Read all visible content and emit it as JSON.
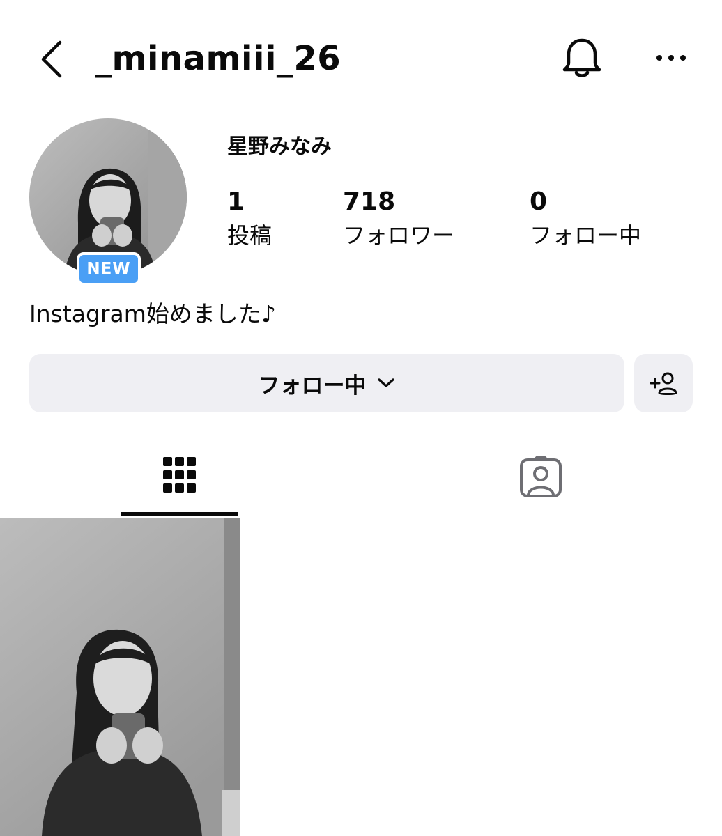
{
  "header": {
    "username": "_minamiii_26",
    "back_icon": "chevron-left-icon",
    "notification_icon": "bell-icon",
    "more_icon": "more-horizontal-icon"
  },
  "profile": {
    "display_name": "星野みなみ",
    "badge": "NEW",
    "bio": "Instagram始めました♪",
    "stats": {
      "posts": {
        "value": "1",
        "label": "投稿"
      },
      "followers": {
        "value": "718",
        "label": "フォロワー"
      },
      "following": {
        "value": "0",
        "label": "フォロー中"
      }
    }
  },
  "actions": {
    "following_label": "フォロー中",
    "following_icon": "chevron-down-icon",
    "add_user_icon": "add-user-icon"
  },
  "tabs": [
    {
      "name": "posts-grid",
      "icon": "grid-icon",
      "active": true
    },
    {
      "name": "tagged",
      "icon": "tagged-user-icon",
      "active": false
    }
  ],
  "colors": {
    "badge": "#4a9ff5",
    "button_bg": "#efeff3",
    "text": "#0a0a0a"
  }
}
